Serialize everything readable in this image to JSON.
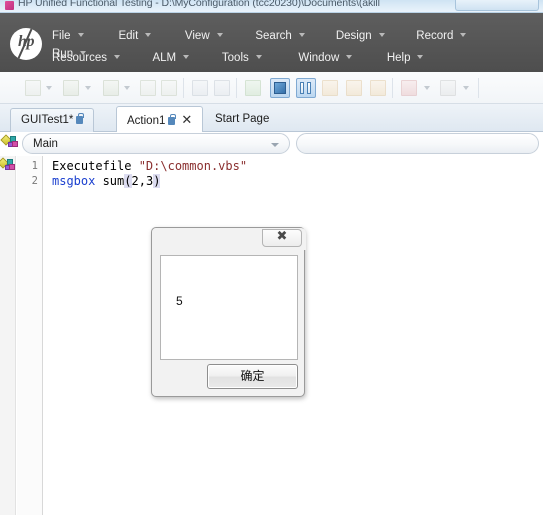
{
  "window": {
    "title": "HP Unified Functional Testing - D:\\MyConfiguration (tcc20230)\\Documents\\(akill",
    "app_icon": "app-icon"
  },
  "menu": {
    "row1": [
      {
        "label": "File",
        "caret": true
      },
      {
        "label": "Edit",
        "caret": true
      },
      {
        "label": "View",
        "caret": true
      },
      {
        "label": "Search",
        "caret": true
      },
      {
        "label": "Design",
        "caret": true
      },
      {
        "label": "Record",
        "caret": true
      },
      {
        "label": "Run",
        "caret": true
      }
    ],
    "row2": [
      {
        "label": "Resources",
        "caret": true
      },
      {
        "label": "ALM",
        "caret": true
      },
      {
        "label": "Tools",
        "caret": true
      },
      {
        "label": "Window",
        "caret": true
      },
      {
        "label": "Help",
        "caret": true
      }
    ],
    "logo_text": "hp"
  },
  "toolbar": {
    "items": [
      {
        "name": "new-document-icon",
        "enabled": false
      },
      {
        "name": "open-file-icon",
        "enabled": false
      },
      {
        "name": "save-icon",
        "enabled": false
      },
      {
        "name": "save-all-icon",
        "enabled": false
      },
      {
        "name": "refresh-icon",
        "enabled": false
      },
      {
        "name": "object-repository-icon",
        "enabled": false
      },
      {
        "name": "run-icon",
        "enabled": false
      },
      {
        "name": "keyword-view-toggle",
        "enabled": true
      },
      {
        "name": "editor-view-toggle",
        "enabled": true
      },
      {
        "name": "indent-icon",
        "enabled": false
      },
      {
        "name": "outdent-icon",
        "enabled": false
      },
      {
        "name": "comment-icon",
        "enabled": false
      },
      {
        "name": "breakpoint-icon",
        "enabled": false
      },
      {
        "name": "bookmark-icon",
        "enabled": false
      }
    ]
  },
  "tabs": [
    {
      "label": "GUITest1*",
      "locked": true,
      "active": false,
      "closable": false
    },
    {
      "label": "Action1",
      "locked": true,
      "active": true,
      "closable": true,
      "close_glyph": "✕"
    },
    {
      "label": "Start Page",
      "locked": false,
      "active": false,
      "closable": false
    }
  ],
  "selector": {
    "action_combo_value": "Main",
    "secondary_combo_value": ""
  },
  "editor": {
    "line_numbers": [
      "1",
      "2"
    ],
    "lines": [
      [
        {
          "text": "Executefile ",
          "type": "plain"
        },
        {
          "text": "\"D:\\common.vbs\"",
          "type": "string"
        }
      ],
      [
        {
          "text": "msgbox ",
          "type": "kw"
        },
        {
          "text": "sum",
          "type": "plain"
        },
        {
          "text": "(",
          "type": "paren"
        },
        {
          "text": "2,3",
          "type": "plain"
        },
        {
          "text": ")",
          "type": "paren"
        }
      ]
    ]
  },
  "dialog": {
    "message": "5",
    "ok_label": "确定",
    "close_glyph": "✖"
  },
  "colors": {
    "menu_band": "#565656",
    "accent_blue": "#4f90c8",
    "string_token": "#8a2f2f",
    "keyword_token": "#1a3fcf",
    "titlebar": "#dcebf7"
  }
}
